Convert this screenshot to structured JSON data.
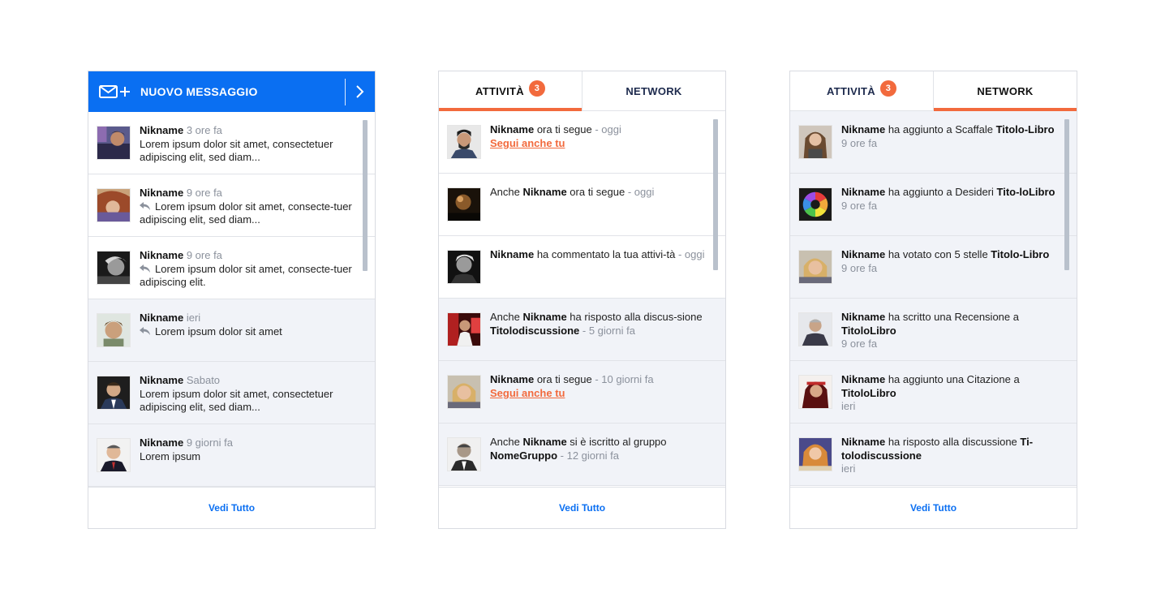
{
  "messages": {
    "header_title": "NUOVO MESSAGGIO",
    "items": [
      {
        "name": "Nikname",
        "time": "3 ore fa",
        "reply": false,
        "text": "Lorem ipsum dolor sit amet, consectetuer adipiscing elit, sed diam..."
      },
      {
        "name": "Nikname",
        "time": "9 ore fa",
        "reply": true,
        "text": "Lorem ipsum dolor sit amet, consecte-tuer adipiscing elit, sed diam..."
      },
      {
        "name": "Nikname",
        "time": "9 ore fa",
        "reply": true,
        "text": "Lorem ipsum dolor sit amet, consecte-tuer adipiscing elit."
      },
      {
        "name": "Nikname",
        "time": "ieri",
        "reply": true,
        "text": "Lorem ipsum dolor sit amet"
      },
      {
        "name": "Nikname",
        "time": "Sabato",
        "reply": false,
        "text": "Lorem ipsum dolor sit amet, consectetuer adipiscing elit, sed diam..."
      },
      {
        "name": "Nikname",
        "time": "9 giorni fa",
        "reply": false,
        "text": "Lorem ipsum"
      }
    ],
    "footer_link": "Vedi Tutto"
  },
  "activity": {
    "tab_activity": "ATTIVITÀ",
    "tab_network": "NETWORK",
    "badge_count": "3",
    "items": [
      {
        "name": "Nikname",
        "pre": "",
        "action": " ora ti segue",
        "object": "",
        "time": " - oggi",
        "link": "Segui anche tu"
      },
      {
        "name": "Nikname",
        "pre": "Anche ",
        "action": " ora ti segue",
        "object": "",
        "time": " - oggi",
        "link": ""
      },
      {
        "name": "Nikname",
        "pre": "",
        "action": " ha commentato la tua attivi-tà",
        "object": "",
        "time": " - oggi",
        "link": ""
      },
      {
        "name": "Nikname",
        "pre": "Anche ",
        "action": " ha risposto alla discus-sione ",
        "object": "Titolodiscussione",
        "time": " - 5 giorni fa",
        "link": ""
      },
      {
        "name": "Nikname",
        "pre": "",
        "action": " ora ti segue ",
        "object": "",
        "time": " - 10 giorni fa",
        "link": "Segui anche tu"
      },
      {
        "name": "Nikname",
        "pre": "Anche ",
        "action": " si è iscritto al gruppo ",
        "object": "NomeGruppo",
        "time": "  - 12 giorni fa",
        "link": ""
      }
    ],
    "footer_link": "Vedi Tutto"
  },
  "network": {
    "tab_activity": "ATTIVITÀ",
    "tab_network": "NETWORK",
    "badge_count": "3",
    "items": [
      {
        "name": "Nikname",
        "action": " ha aggiunto a Scaffale ",
        "object": "Titolo-Libro",
        "time": "9 ore fa"
      },
      {
        "name": "Nikname",
        "action": " ha aggiunto a Desideri ",
        "object": "Tito-loLibro",
        "time": "9 ore fa"
      },
      {
        "name": "Nikname",
        "action": " ha votato con 5 stelle ",
        "object": "Titolo-Libro",
        "time": "9 ore fa"
      },
      {
        "name": "Nikname",
        "action": " ha scritto una Recensione a ",
        "object": "TitoloLibro",
        "time": "9 ore fa"
      },
      {
        "name": "Nikname",
        "action": " ha aggiunto una Citazione a ",
        "object": "TitoloLibro",
        "time": "ieri"
      },
      {
        "name": "Nikname",
        "action": " ha risposto alla discussione ",
        "object": "Ti-tolodiscussione",
        "time": "ieri"
      }
    ],
    "footer_link": "Vedi Tutto"
  },
  "colors": {
    "accent_blue": "#0a6ff2",
    "accent_orange": "#f26a3d",
    "read_row_bg": "#f1f3f8",
    "muted_text": "#8b919c"
  }
}
